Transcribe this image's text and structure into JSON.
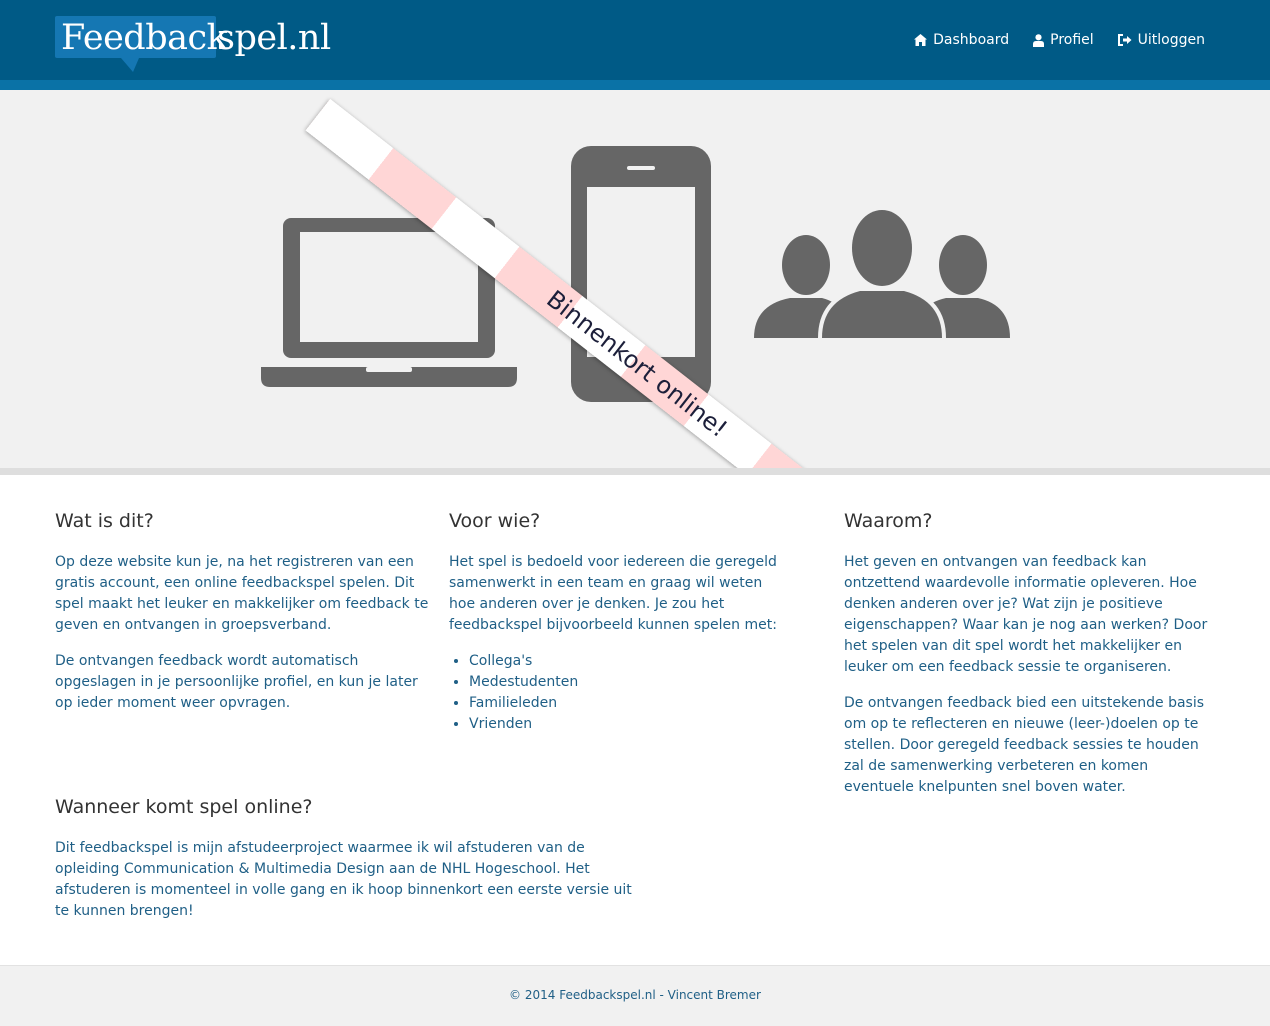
{
  "header": {
    "logo": {
      "part1": "Feedback",
      "part2": "spel.nl"
    },
    "nav": [
      {
        "label": "Dashboard",
        "icon": "home-icon"
      },
      {
        "label": "Profiel",
        "icon": "user-icon"
      },
      {
        "label": "Uitloggen",
        "icon": "sign-out-icon"
      }
    ]
  },
  "hero": {
    "ribbon_text": "Binnenkort online!",
    "icons": [
      "laptop-icon",
      "smartphone-icon",
      "users-group-icon"
    ]
  },
  "sections": {
    "what": {
      "title": "Wat is dit?",
      "paragraphs": [
        "Op deze website kun je, na het registreren van een gratis account, een online feedbackspel spelen. Dit spel maakt het leuker en makkelijker om feedback te geven en ontvangen in groepsverband.",
        "De ontvangen feedback wordt automatisch opgeslagen in je persoonlijke profiel, en kun je later op ieder moment weer opvragen."
      ]
    },
    "who": {
      "title": "Voor wie?",
      "paragraphs": [
        "Het spel is bedoeld voor iedereen die geregeld samenwerkt in een team en graag wil weten hoe anderen over je denken. Je zou het feedbackspel bijvoorbeeld kunnen spelen met:"
      ],
      "list": [
        "Collega's",
        "Medestudenten",
        "Familieleden",
        "Vrienden"
      ]
    },
    "why": {
      "title": "Waarom?",
      "paragraphs": [
        "Het geven en ontvangen van feedback kan ontzettend waardevolle informatie opleveren. Hoe denken anderen over je? Wat zijn je positieve eigenschappen? Waar kan je nog aan werken? Door het spelen van dit spel wordt het makkelijker en leuker om een feedback sessie te organiseren.",
        "De ontvangen feedback bied een uitstekende basis om op te reflecteren en nieuwe (leer-)doelen op te stellen. Door geregeld feedback sessies te houden zal de samenwerking verbeteren en komen eventuele knelpunten snel boven water."
      ]
    },
    "when": {
      "title": "Wanneer komt spel online?",
      "paragraphs": [
        "Dit feedbackspel is mijn afstudeerproject waarmee ik wil afstuderen van de opleiding Communication & Multimedia Design aan de NHL Hogeschool. Het afstuderen is momenteel in volle gang en ik hoop binnenkort een eerste versie uit te kunnen brengen!"
      ]
    }
  },
  "footer": {
    "text": "© 2014 Feedbackspel.nl - Vincent Bremer"
  },
  "colors": {
    "header": "#005a86",
    "header_stripe": "#0a72a6",
    "logo_box": "#1577b3",
    "text_blue": "#1f5f86",
    "heading": "#333333",
    "hero_bg": "#f1f1f1",
    "icon_gray": "#666666",
    "ribbon_pink": "#ffd6d6"
  }
}
